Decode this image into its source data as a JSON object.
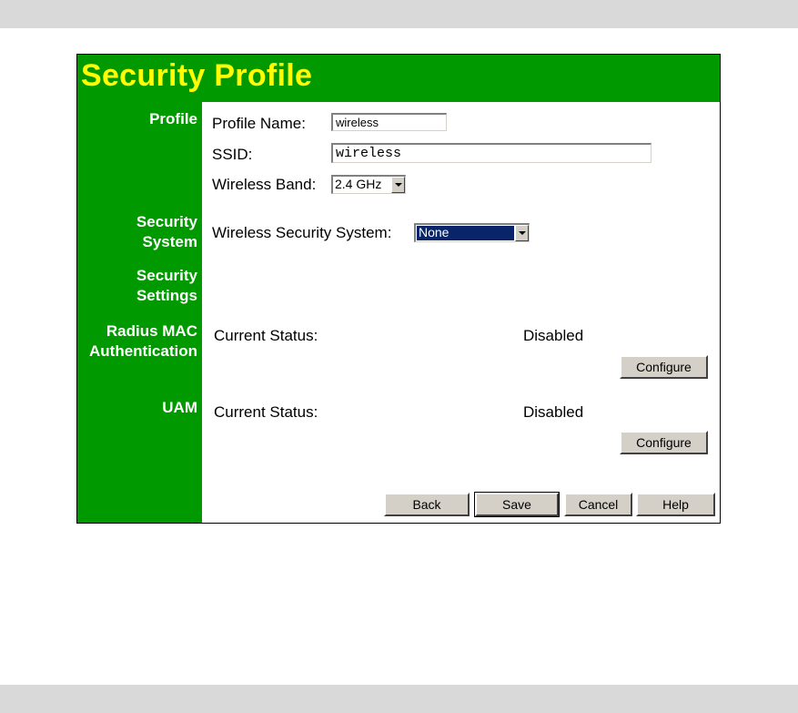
{
  "page": {
    "title": "Security Profile"
  },
  "sidebar": {
    "profile": "Profile",
    "security_system": [
      "Security",
      "System"
    ],
    "security_settings": [
      "Security",
      "Settings"
    ],
    "radius_mac": [
      "Radius MAC",
      "Authentication"
    ],
    "uam": "UAM"
  },
  "profile": {
    "name_label": "Profile Name:",
    "name_value": "wireless",
    "ssid_label": "SSID:",
    "ssid_value": "wireless",
    "band_label": "Wireless Band:",
    "band_value": "2.4 GHz"
  },
  "security_system": {
    "label": "Wireless Security System:",
    "value": "None"
  },
  "radius_mac": {
    "status_label": "Current Status:",
    "status_value": "Disabled",
    "configure_label": "Configure"
  },
  "uam": {
    "status_label": "Current Status:",
    "status_value": "Disabled",
    "configure_label": "Configure"
  },
  "actions": {
    "back": "Back",
    "save": "Save",
    "cancel": "Cancel",
    "help": "Help"
  },
  "colors": {
    "accent_green": "#009900",
    "title_yellow": "#ffff00"
  }
}
